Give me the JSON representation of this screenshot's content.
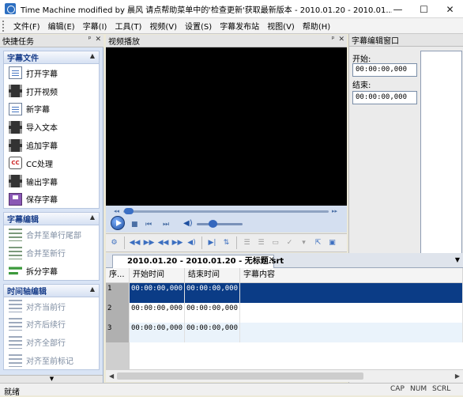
{
  "window": {
    "title": "Time Machine modified by 晨风 请点帮助菜单中的'检查更新'获取最新版本 - 2010.01.20 - 2010.01...",
    "controls": [
      "—",
      "☐",
      "✕"
    ]
  },
  "menu": [
    "文件(F)",
    "编辑(E)",
    "字幕(I)",
    "工具(T)",
    "视频(V)",
    "设置(S)",
    "字幕发布站",
    "视图(V)",
    "帮助(H)"
  ],
  "panels": {
    "quick_tasks": "快捷任务",
    "video": "视频播放",
    "subtitle_editor": "字幕编辑窗口",
    "pin": "ᵖ",
    "close": "✕"
  },
  "task_groups": [
    {
      "title": "字幕文件",
      "items": [
        {
          "label": "打开字幕",
          "icon": "open-subtitle-icon"
        },
        {
          "label": "打开视频",
          "icon": "open-video-icon"
        },
        {
          "label": "新字幕",
          "icon": "new-subtitle-icon"
        },
        {
          "label": "导入文本",
          "icon": "import-text-icon"
        },
        {
          "label": "追加字幕",
          "icon": "append-subtitle-icon"
        },
        {
          "label": "CC处理",
          "icon": "cc-icon"
        },
        {
          "label": "输出字幕",
          "icon": "export-subtitle-icon"
        },
        {
          "label": "保存字幕",
          "icon": "save-icon"
        }
      ]
    },
    {
      "title": "字幕编辑",
      "items": [
        {
          "label": "合并至单行尾部",
          "icon": "merge-line-end-icon"
        },
        {
          "label": "合并至新行",
          "icon": "merge-new-line-icon"
        },
        {
          "label": "拆分字幕",
          "icon": "split-subtitle-icon"
        }
      ]
    },
    {
      "title": "时间轴编辑",
      "items": [
        {
          "label": "对齐当前行",
          "icon": "align-current-icon"
        },
        {
          "label": "对齐后续行",
          "icon": "align-following-icon"
        },
        {
          "label": "对齐全部行",
          "icon": "align-all-icon"
        },
        {
          "label": "对齐至前标记",
          "icon": "align-prev-mark-icon"
        }
      ]
    }
  ],
  "editor": {
    "start_label": "开始:",
    "start_value": "00:00:00,000",
    "end_label": "结束:",
    "end_value": "00:00:00,000"
  },
  "document": {
    "tab_title": "2010.01.20 - 2010.01.20 - 无标题.srt"
  },
  "grid": {
    "columns": [
      "序...",
      "开始时间",
      "结束时间",
      "字幕内容"
    ],
    "rows": [
      {
        "num": "1",
        "start": "00:00:00,000",
        "end": "00:00:00,000",
        "text": ""
      },
      {
        "num": "2",
        "start": "00:00:00,000",
        "end": "00:00:00,000",
        "text": ""
      },
      {
        "num": "3",
        "start": "00:00:00,000",
        "end": "00:00:00,000",
        "text": ""
      }
    ]
  },
  "status": {
    "left": "就绪",
    "cap": "CAP",
    "num": "NUM",
    "scrl": "SCRL"
  },
  "colors": {
    "selection": "#0b3c86",
    "task_header": "#1a3f8b",
    "panel_bg": "#d9e4f5"
  }
}
